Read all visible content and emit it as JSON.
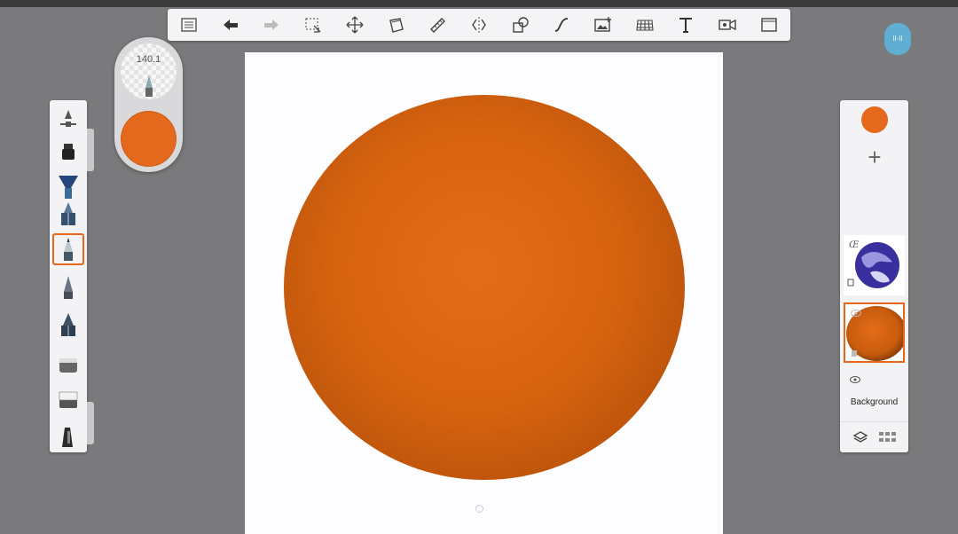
{
  "brush": {
    "size": "140.1"
  },
  "colors": {
    "accent": "#e5691c",
    "paint": "#e5691c"
  },
  "toolbar": {
    "tools": [
      "gallery-icon",
      "undo-icon",
      "redo-icon",
      "selection-icon",
      "transform-icon",
      "fill-icon",
      "ruler-icon",
      "symmetry-icon",
      "shape-icon",
      "curve-icon",
      "image-import-icon",
      "perspective-icon",
      "text-icon",
      "video-icon",
      "fullscreen-icon"
    ]
  },
  "brushes": [
    "brush-settings-icon",
    "marker-icon",
    "fan-brush-icon",
    "airbrush-icon",
    "pencil-icon",
    "pen-icon",
    "ballpoint-icon",
    "flat-brush-icon",
    "eraser-icon",
    "smudge-icon"
  ],
  "layers": {
    "background_label": "Background",
    "items": [
      {
        "name": "earth-layer"
      },
      {
        "name": "sphere-layer",
        "selected": true
      }
    ]
  },
  "avatar": {
    "text": "II-II"
  }
}
